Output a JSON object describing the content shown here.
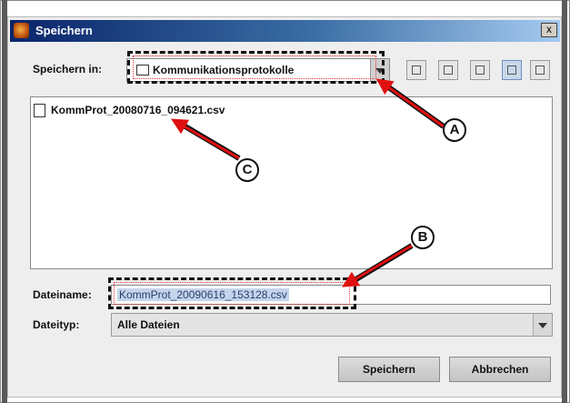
{
  "window": {
    "title": "Speichern",
    "close_label": "x"
  },
  "save_in": {
    "label": "Speichern in:",
    "folder": "Kommunikationsprotokolle"
  },
  "toolbar_icons": [
    "up-folder-icon",
    "home-icon",
    "new-folder-icon",
    "list-view-icon",
    "details-view-icon"
  ],
  "files": [
    {
      "name": "KommProt_20080716_094621.csv"
    }
  ],
  "filename": {
    "label": "Dateiname:",
    "value": "KommProt_20090616_153128.csv"
  },
  "filetype": {
    "label": "Dateityp:",
    "value": "Alle Dateien"
  },
  "buttons": {
    "save": "Speichern",
    "cancel": "Abbrechen"
  },
  "annotations": [
    {
      "label": "A"
    },
    {
      "label": "B"
    },
    {
      "label": "C"
    }
  ],
  "colors": {
    "title_bar": "#0a246a",
    "annotation_arrow": "#e01010",
    "selection": "#c4d4ea"
  }
}
